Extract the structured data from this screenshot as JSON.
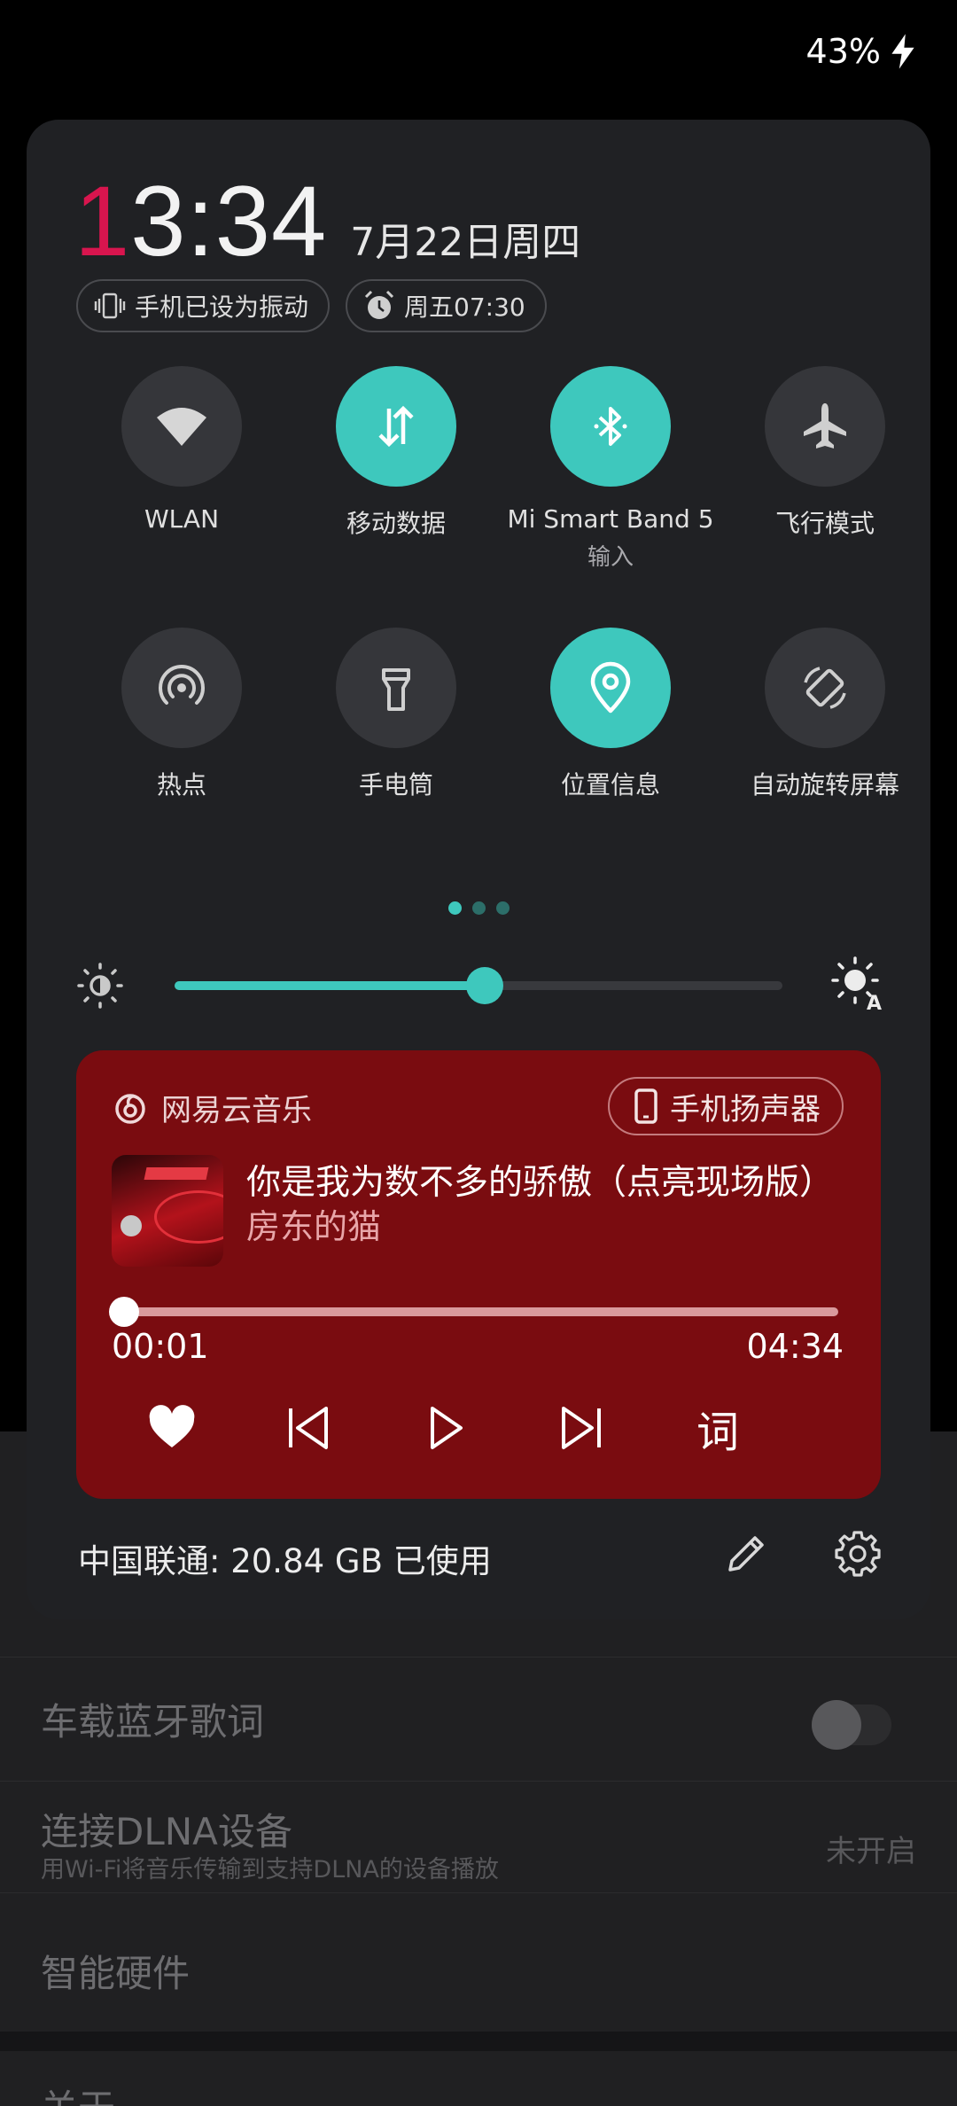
{
  "status_bar": {
    "battery": "43%"
  },
  "panel": {
    "clock": {
      "time_first_digit": "1",
      "time_rest": "3:34",
      "date": "7月22日周四"
    },
    "chips": [
      {
        "icon": "vibrate-icon",
        "label": "手机已设为振动"
      },
      {
        "icon": "alarm-icon",
        "label": "周五07:30"
      }
    ],
    "tiles": [
      {
        "label": "WLAN",
        "sublabel": "",
        "active": false,
        "icon": "wifi-icon"
      },
      {
        "label": "移动数据",
        "sublabel": "",
        "active": true,
        "icon": "mobile-data-icon"
      },
      {
        "label": "Mi Smart Band 5",
        "sublabel": "输入",
        "active": true,
        "icon": "bluetooth-icon"
      },
      {
        "label": "飞行模式",
        "sublabel": "",
        "active": false,
        "icon": "airplane-icon"
      },
      {
        "label": "热点",
        "sublabel": "",
        "active": false,
        "icon": "hotspot-icon"
      },
      {
        "label": "手电筒",
        "sublabel": "",
        "active": false,
        "icon": "flashlight-icon"
      },
      {
        "label": "位置信息",
        "sublabel": "",
        "active": true,
        "icon": "location-icon"
      },
      {
        "label": "自动旋转屏幕",
        "sublabel": "",
        "active": false,
        "icon": "auto-rotate-icon"
      }
    ],
    "page_indicator": {
      "count": 3,
      "active_index": 0
    },
    "brightness": {
      "level": 0.51
    },
    "media": {
      "app_name": "网易云音乐",
      "output_device": "手机扬声器",
      "song_title": "你是我为数不多的骄傲（点亮现场版）",
      "artist": "房东的猫",
      "progress": 0.004,
      "time_current": "00:01",
      "time_total": "04:34",
      "lyrics_label": "词"
    },
    "footer": {
      "data_usage": "中国联通: 20.84 GB 已使用"
    }
  },
  "background_app": {
    "rows": [
      {
        "title": "车载蓝牙歌词",
        "subtitle": "",
        "value": ""
      },
      {
        "title": "连接DLNA设备",
        "subtitle": "用Wi-Fi将音乐传输到支持DLNA的设备播放",
        "value": "未开启"
      },
      {
        "title": "智能硬件",
        "subtitle": "",
        "value": ""
      },
      {
        "title": "关于",
        "subtitle": "",
        "value": ""
      }
    ]
  },
  "colors": {
    "accent": "#3ec8bd",
    "clock_accent": "#d8154e",
    "media_bg": "#7a0c10",
    "panel_bg": "#202124"
  }
}
